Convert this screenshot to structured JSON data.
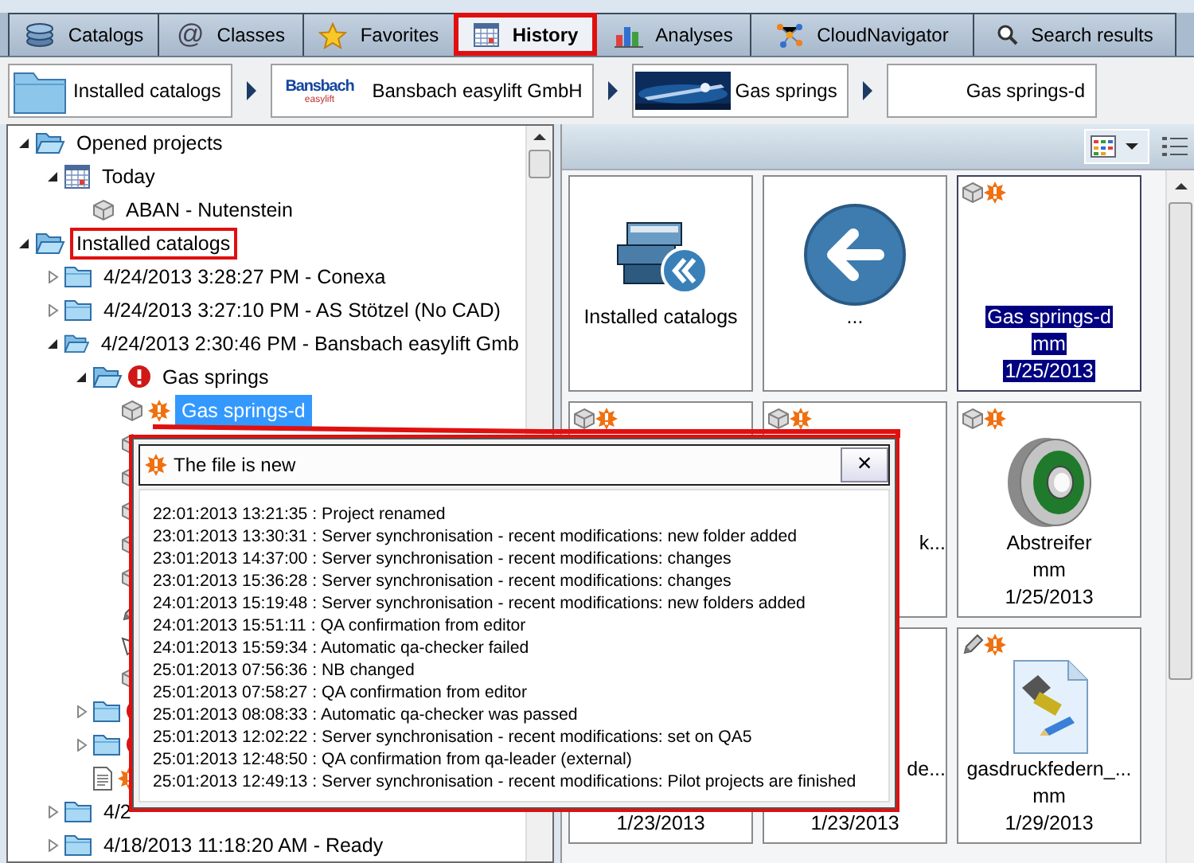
{
  "tabs": [
    {
      "label": "Catalogs",
      "selected": false,
      "highlighted": false
    },
    {
      "label": "Classes",
      "glyph": "@",
      "selected": false,
      "highlighted": false
    },
    {
      "label": "Favorites",
      "selected": false,
      "highlighted": false
    },
    {
      "label": "History",
      "selected": true,
      "highlighted": true
    },
    {
      "label": "Analyses",
      "selected": false,
      "highlighted": false
    },
    {
      "label": "CloudNavigator",
      "selected": false,
      "highlighted": false
    },
    {
      "label": "Search results",
      "selected": false,
      "highlighted": false
    }
  ],
  "breadcrumb": [
    {
      "label": "Installed catalogs"
    },
    {
      "label": "Bansbach easylift GmbH",
      "logo": "Bansbach",
      "logo_sub": "easylift"
    },
    {
      "label": "Gas springs"
    },
    {
      "label": "Gas springs-d"
    }
  ],
  "tree": [
    {
      "label": "Opened projects",
      "kind": "folder",
      "expanded": true,
      "selected": false,
      "highlighted": false,
      "children": [
        {
          "label": "Today",
          "kind": "calendar",
          "expanded": true,
          "selected": false,
          "highlighted": false,
          "children": [
            {
              "label": "ABAN - Nutenstein",
              "kind": "part",
              "selected": false,
              "highlighted": false
            }
          ]
        }
      ]
    },
    {
      "label": "Installed catalogs",
      "kind": "folder",
      "expanded": true,
      "selected": false,
      "highlighted": true,
      "children": [
        {
          "label": "4/24/2013 3:28:27 PM - Conexa",
          "kind": "folder",
          "expanded": false,
          "selected": false,
          "highlighted": false
        },
        {
          "label": "4/24/2013 3:27:10 PM - AS Stötzel (No CAD)",
          "kind": "folder",
          "expanded": false,
          "selected": false,
          "highlighted": false
        },
        {
          "label": "4/24/2013 2:30:46 PM - Bansbach easylift Gmb",
          "kind": "folder",
          "expanded": true,
          "selected": false,
          "highlighted": false,
          "children": [
            {
              "label": "Gas springs",
              "kind": "folder",
              "error": true,
              "expanded": true,
              "selected": false,
              "highlighted": false,
              "children": [
                {
                  "label": "Gas springs-d",
                  "kind": "part",
                  "new": true,
                  "selected": true,
                  "highlighted": false
                },
                {
                  "kind": "part",
                  "selected": false,
                  "highlighted": false
                },
                {
                  "kind": "part",
                  "selected": false,
                  "highlighted": false
                },
                {
                  "kind": "part",
                  "selected": false,
                  "highlighted": false
                },
                {
                  "kind": "part",
                  "selected": false,
                  "highlighted": false
                },
                {
                  "kind": "part",
                  "selected": false,
                  "highlighted": false
                },
                {
                  "kind": "sketch",
                  "selected": false,
                  "highlighted": false
                },
                {
                  "kind": "shape",
                  "selected": false,
                  "highlighted": false
                },
                {
                  "kind": "part",
                  "selected": false,
                  "highlighted": false
                }
              ]
            },
            {
              "kind": "folder",
              "error": true,
              "expanded": false,
              "selected": false,
              "highlighted": false
            },
            {
              "kind": "folder",
              "error": true,
              "expanded": false,
              "selected": false,
              "highlighted": false
            },
            {
              "kind": "document",
              "new": true,
              "selected": false,
              "highlighted": false
            }
          ]
        },
        {
          "label": "4/2",
          "kind": "folder",
          "expanded": false,
          "selected": false,
          "highlighted": false
        },
        {
          "label": "4/18/2013 11:18:20 AM - Ready",
          "kind": "folder",
          "expanded": false,
          "selected": false,
          "highlighted": false
        }
      ]
    }
  ],
  "tiles": [
    {
      "kind": "catalog",
      "caption": "Installed catalogs",
      "selected": false
    },
    {
      "kind": "back",
      "caption": "...",
      "selected": false
    },
    {
      "kind": "part",
      "new": true,
      "caption": "Gas springs-d",
      "unit": "mm",
      "date": "1/25/2013",
      "selected": true
    },
    {
      "kind": "covered",
      "new": true,
      "selected": false
    },
    {
      "kind": "covered",
      "new": true,
      "caption": "k...",
      "selected": false
    },
    {
      "kind": "ring",
      "new": true,
      "caption": "Abstreifer",
      "unit": "mm",
      "date": "1/25/2013",
      "selected": false
    },
    {
      "kind": "covered",
      "date": "1/23/2013",
      "selected": false
    },
    {
      "kind": "covered",
      "caption": "de...",
      "date": "1/23/2013",
      "selected": false
    },
    {
      "kind": "document",
      "new": true,
      "caption": "gasdruckfedern_...",
      "unit": "mm",
      "date": "1/29/2013",
      "selected": false
    }
  ],
  "popup": {
    "title": "The file is new",
    "close": "×",
    "highlighted": true,
    "lines": [
      "22:01:2013 13:21:35 : Project renamed",
      "23:01:2013 13:30:31 : Server synchronisation - recent modifications: new folder added",
      "23:01:2013 14:37:00 : Server synchronisation - recent modifications: changes",
      "23:01:2013 15:36:28 : Server synchronisation - recent modifications: changes",
      "24:01:2013 15:19:48 : Server synchronisation - recent modifications: new folders added",
      "24:01:2013 15:51:11 : QA confirmation from editor",
      "24:01:2013 15:59:34 : Automatic qa-checker failed",
      "25:01:2013 07:56:36 : NB changed",
      "25:01:2013 07:58:27 : QA confirmation from editor",
      "25:01:2013 08:08:33 : Automatic qa-checker was passed",
      "25:01:2013 12:02:22 : Server synchronisation - recent modifications: set on QA5",
      "25:01:2013 12:48:50 : QA confirmation from qa-leader (external)",
      "25:01:2013 12:49:13 : Server synchronisation - recent modifications: Pilot projects are finished"
    ]
  }
}
